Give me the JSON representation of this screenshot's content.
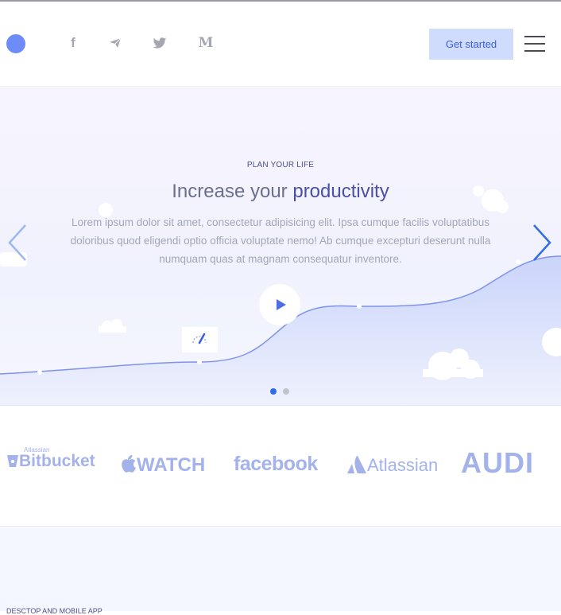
{
  "header": {
    "social": [
      {
        "name": "facebook-icon",
        "glyph": "f"
      },
      {
        "name": "telegram-icon",
        "glyph": "➤"
      },
      {
        "name": "twitter-icon",
        "glyph": "🐦"
      },
      {
        "name": "medium-icon",
        "glyph": "M"
      }
    ],
    "cta_label": "Get started"
  },
  "hero": {
    "eyebrow": "PLAN YOUR LIFE",
    "title_lead": "Increase your ",
    "title_highlight": "productivity",
    "lead_text": "Lorem ipsum dolor sit amet, consectetur adipisicing elit. Ipsa cumque facilis voluptatibus doloribus quod eligendi optio officia voluptate nemo! Ab cumque excepturi deserunt nulla numquam quas at magnam consequatur inventore.",
    "slide_count": 2,
    "active_slide": 1
  },
  "brands": {
    "bitbucket_small": "Atlassian",
    "bitbucket": "Bitbucket",
    "watch": "WATCH",
    "facebook": "facebook",
    "atlassian": "Atlassian",
    "audi": "Audi"
  },
  "next_section": {
    "eyebrow": "DESCTOP AND MOBILE APP"
  },
  "colors": {
    "accent": "#3d5fe0",
    "brand_logo": "#a3b2ea",
    "cta_bg": "#cfdcfb"
  }
}
